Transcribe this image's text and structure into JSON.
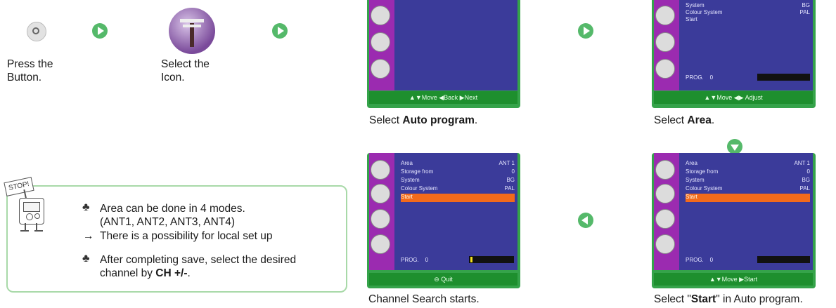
{
  "step1": {
    "line1": "Press the",
    "line2": "Button."
  },
  "step2": {
    "line1": "Select the",
    "line2": "Icon."
  },
  "screen_auto": {
    "nav": "▲▼Move  ◀Back  ▶Next",
    "caption_pre": "Select ",
    "caption_bold": "Auto program",
    "caption_post": "."
  },
  "screen_area": {
    "rows": [
      {
        "label": "System",
        "value": "BG"
      },
      {
        "label": "Colour System",
        "value": "PAL"
      },
      {
        "label": "Start",
        "value": ""
      }
    ],
    "prog_label": "PROG.",
    "prog_value": "0",
    "nav": "▲▼Move  ◀▶ Adjust",
    "caption_pre": "Select ",
    "caption_bold": "Area",
    "caption_post": "."
  },
  "screen_channel": {
    "rows": [
      {
        "label": "Area",
        "value": "ANT 1"
      },
      {
        "label": "Storage from",
        "value": "0"
      },
      {
        "label": "System",
        "value": "BG"
      },
      {
        "label": "Colour System",
        "value": "PAL"
      },
      {
        "label": "Start",
        "value": ""
      }
    ],
    "prog_label": "PROG.",
    "prog_value": "0",
    "nav": "⊖ Quit",
    "caption": "Channel Search starts."
  },
  "screen_start": {
    "rows": [
      {
        "label": "Area",
        "value": "ANT 1"
      },
      {
        "label": "Storage from",
        "value": "0"
      },
      {
        "label": "System",
        "value": "BG"
      },
      {
        "label": "Colour System",
        "value": "PAL"
      },
      {
        "label": "Start",
        "value": ""
      }
    ],
    "prog_label": "PROG.",
    "prog_value": "0",
    "nav": "▲▼Move  ▶Start",
    "caption_pre": "Select \"",
    "caption_bold": "Start",
    "caption_post": "\" in Auto program."
  },
  "note": {
    "stop_sign": "STOP!",
    "bullet1_line1": "Area can be done in 4 modes.",
    "bullet1_line2": "(ANT1, ANT2, ANT3, ANT4)",
    "bullet1_line3": "There is a possibility for local set up",
    "bullet2_line1": "After completing save, select the desired",
    "bullet2_line2_pre": "channel by ",
    "bullet2_line2_bold": "CH +/-",
    "bullet2_line2_post": "."
  },
  "colors": {
    "arrow": "#55b96a",
    "tv_green": "#35a34a",
    "tv_purple": "#9b2bb0",
    "tv_blue": "#3b3b9a",
    "highlight": "#f26a1b"
  }
}
